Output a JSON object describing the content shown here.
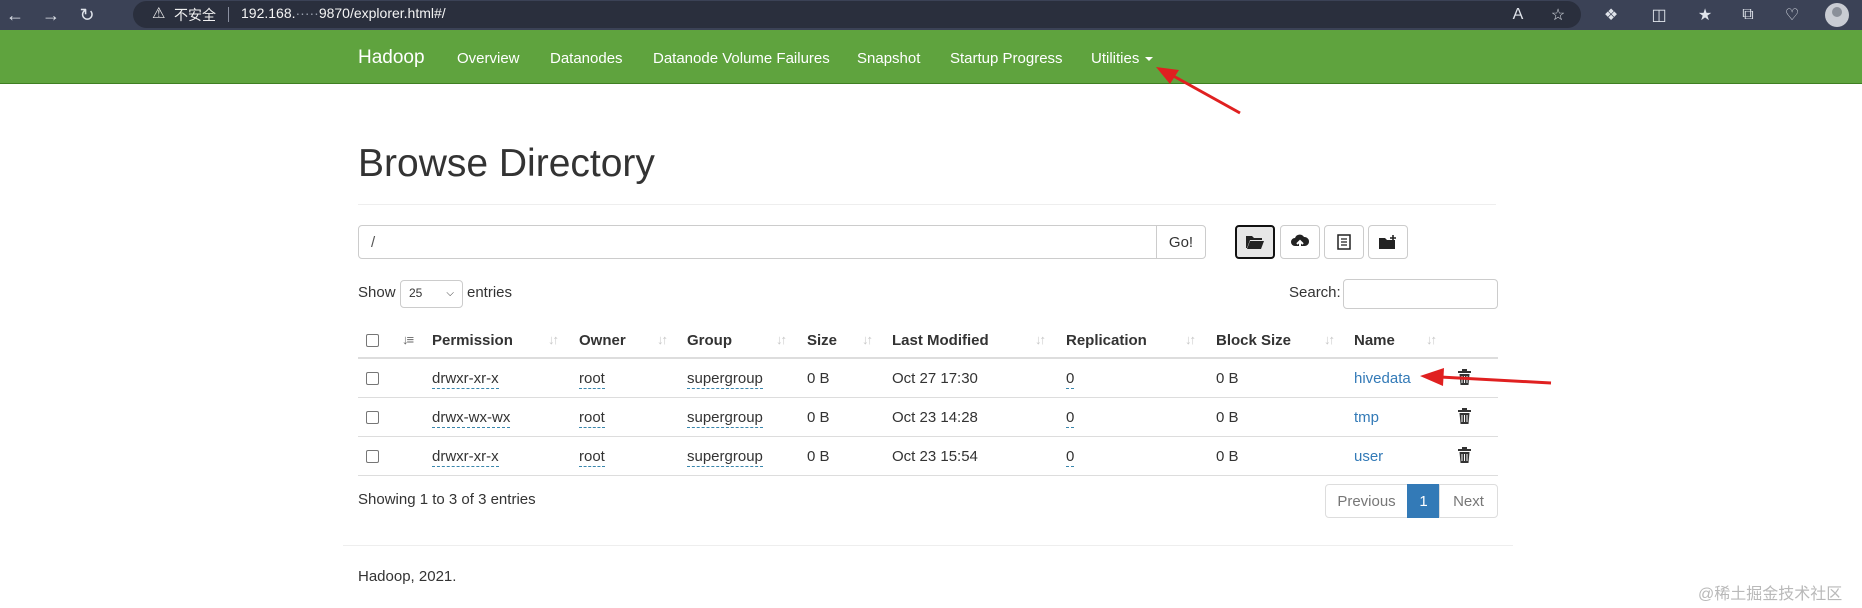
{
  "browser": {
    "insecure_label": "不安全",
    "url_prefix": "192.168.",
    "url_masked": "·····",
    "url_suffix": "9870/explorer.html#/"
  },
  "navbar": {
    "brand": "Hadoop",
    "items": [
      "Overview",
      "Datanodes",
      "Datanode Volume Failures",
      "Snapshot",
      "Startup Progress",
      "Utilities"
    ]
  },
  "page": {
    "title": "Browse Directory",
    "path_value": "/",
    "go_label": "Go!",
    "show_label": "Show",
    "page_size": "25",
    "entries_label": "entries",
    "search_label": "Search:"
  },
  "table": {
    "columns": [
      "Permission",
      "Owner",
      "Group",
      "Size",
      "Last Modified",
      "Replication",
      "Block Size",
      "Name"
    ],
    "rows": [
      {
        "permission": "drwxr-xr-x",
        "owner": "root",
        "group": "supergroup",
        "size": "0 B",
        "modified": "Oct 27 17:30",
        "replication": "0",
        "block_size": "0 B",
        "name": "hivedata"
      },
      {
        "permission": "drwx-wx-wx",
        "owner": "root",
        "group": "supergroup",
        "size": "0 B",
        "modified": "Oct 23 14:28",
        "replication": "0",
        "block_size": "0 B",
        "name": "tmp"
      },
      {
        "permission": "drwxr-xr-x",
        "owner": "root",
        "group": "supergroup",
        "size": "0 B",
        "modified": "Oct 23 15:54",
        "replication": "0",
        "block_size": "0 B",
        "name": "user"
      }
    ]
  },
  "pagination": {
    "info": "Showing 1 to 3 of 3 entries",
    "previous": "Previous",
    "current": "1",
    "next": "Next"
  },
  "footer": {
    "text": "Hadoop, 2021."
  },
  "watermark": "@稀土掘金技术社区",
  "colors": {
    "navbar": "#5fa33e",
    "link": "#337ab7",
    "annotation": "#e02020"
  },
  "icons": [
    "back-icon",
    "forward-icon",
    "refresh-icon",
    "warning-icon",
    "read-aloud-icon",
    "favorite-icon",
    "extensions-icon",
    "split-screen-icon",
    "favorites-icon",
    "collections-icon",
    "performance-icon",
    "profile-avatar",
    "folder-open-icon",
    "cloud-upload-icon",
    "list-icon",
    "folder-add-icon",
    "trash-icon"
  ]
}
